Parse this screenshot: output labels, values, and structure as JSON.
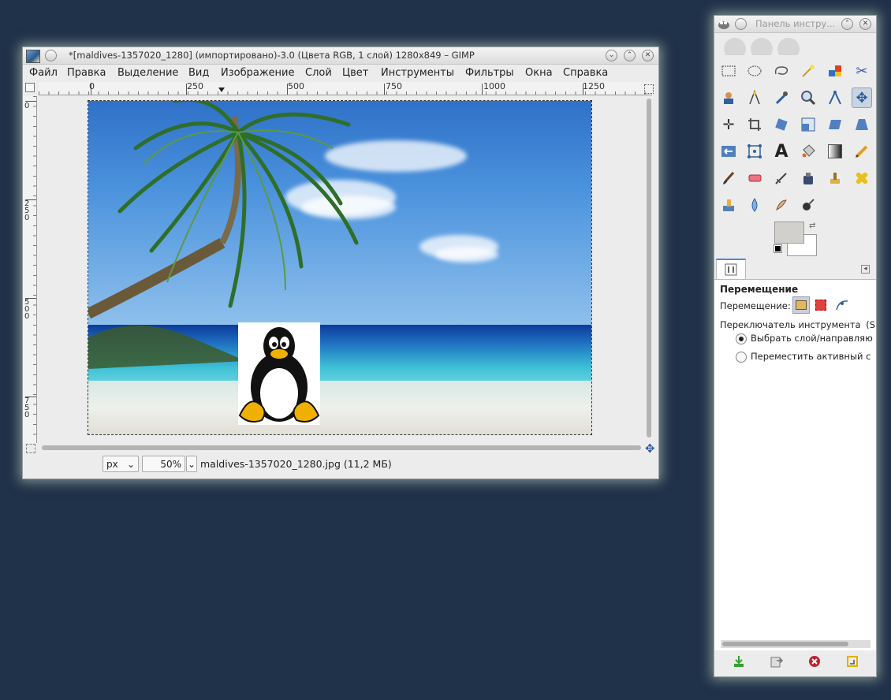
{
  "main_window": {
    "title": "*[maldives-1357020_1280] (импортировано)-3.0 (Цвета RGB, 1 слой) 1280x849 – GIMP",
    "menu": [
      "Файл",
      "Правка",
      "Выделение",
      "Вид",
      "Изображение",
      "Слой",
      "Цвет",
      "Инструменты",
      "Фильтры",
      "Окна",
      "Справка"
    ],
    "hruler_labels": [
      "0",
      "250",
      "500",
      "750",
      "1000",
      "1250"
    ],
    "vruler_labels": [
      "0",
      "250",
      "500",
      "750"
    ],
    "unit": "px",
    "zoom": "50%",
    "status_text": "maldives-1357020_1280.jpg (11,2 МБ)"
  },
  "toolbox": {
    "title": "Панель инстру...",
    "tool_options": {
      "title": "Перемещение",
      "move_label": "Перемещение:",
      "switch_label": "Переключатель инструмента",
      "switch_hint": "(S",
      "radio_1": "Выбрать слой/направляю",
      "radio_2": "Переместить активный с"
    },
    "colors": {
      "foreground": "#d2d0cc",
      "background": "#ffffff"
    }
  }
}
